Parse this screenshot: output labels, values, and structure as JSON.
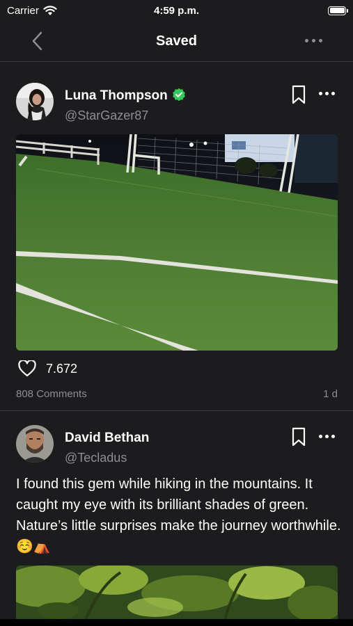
{
  "status": {
    "carrier": "Carrier",
    "time": "4:59 p.m."
  },
  "nav": {
    "title": "Saved",
    "back_icon": "chevron-left-icon",
    "more_icon": "ellipsis-icon"
  },
  "posts": [
    {
      "name": "Luna Thompson",
      "handle": "@StarGazer87",
      "verified": true,
      "likes": "7.672",
      "comments": "808  Comments",
      "age": "1 d",
      "image": "soccer-field-photo"
    },
    {
      "name": "David Bethan",
      "handle": "@Tecladus",
      "verified": false,
      "text": "I found this gem while hiking in the mountains.  It caught my eye with its brilliant shades of green. Nature’s little surprises make the journey worthwhile. ☺️⛺",
      "image": "green-leaves-photo"
    }
  ],
  "colors": {
    "background": "#1c1c1e",
    "secondary_text": "#8e8e93",
    "verified_badge": "#34c759",
    "divider": "#3a3a3c"
  }
}
